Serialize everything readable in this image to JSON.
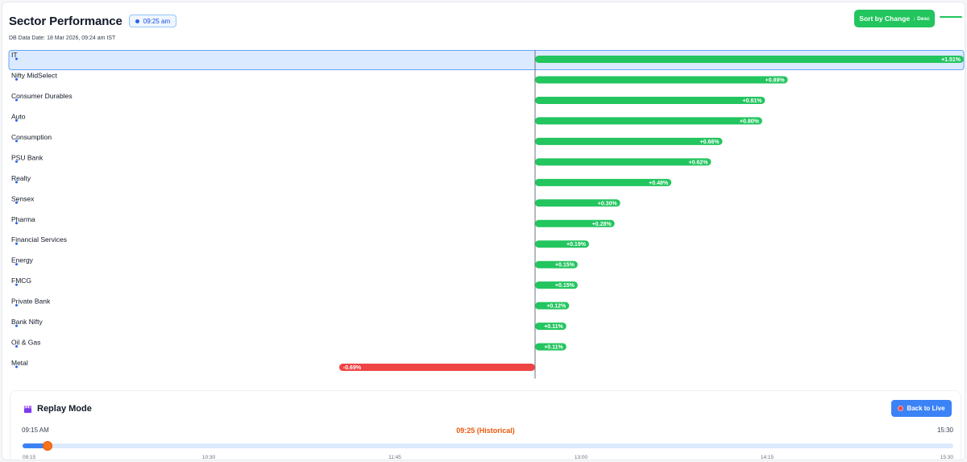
{
  "header": {
    "title": "Sector Performance",
    "time_badge": "09:25 am",
    "db_date": "DB Data Date: 18 Mar 2026, 09:24 am IST",
    "sort_label": "Sort by Change",
    "sort_dir": "↓ Desc"
  },
  "colors": {
    "positive": "#22c55e",
    "negative": "#ef4444",
    "selected_row": "#dbeafe",
    "accent": "#3b82f6",
    "scrub": "#f97316"
  },
  "chart_data": {
    "type": "bar",
    "orientation": "horizontal",
    "categories": [
      "IT",
      "Nifty MidSelect",
      "Consumer Durables",
      "Auto",
      "Consumption",
      "PSU Bank",
      "Realty",
      "Sensex",
      "Pharma",
      "Financial Services",
      "Energy",
      "FMCG",
      "Private Bank",
      "Bank Nifty",
      "Oil & Gas",
      "Metal"
    ],
    "values": [
      1.51,
      0.89,
      0.81,
      0.8,
      0.66,
      0.62,
      0.48,
      0.3,
      0.28,
      0.19,
      0.15,
      0.15,
      0.12,
      0.11,
      0.11,
      -0.69
    ],
    "labels": [
      "+1.51%",
      "+0.89%",
      "+0.81%",
      "+0.80%",
      "+0.66%",
      "+0.62%",
      "+0.48%",
      "+0.30%",
      "+0.28%",
      "+0.19%",
      "+0.15%",
      "+0.15%",
      "+0.12%",
      "+0.11%",
      "+0.11%",
      "-0.69%"
    ],
    "xlim": [
      -1.51,
      1.51
    ],
    "selected": "IT",
    "grid": false
  },
  "replay": {
    "title": "Replay Mode",
    "back_label": "Back to Live",
    "start_label": "09:15 AM",
    "end_label": "15:30",
    "current_label": "09:25 (Historical)",
    "progress": 0.0267,
    "ticks": [
      "09:15",
      "10:30",
      "11:45",
      "13:00",
      "14:15",
      "15:30"
    ]
  }
}
